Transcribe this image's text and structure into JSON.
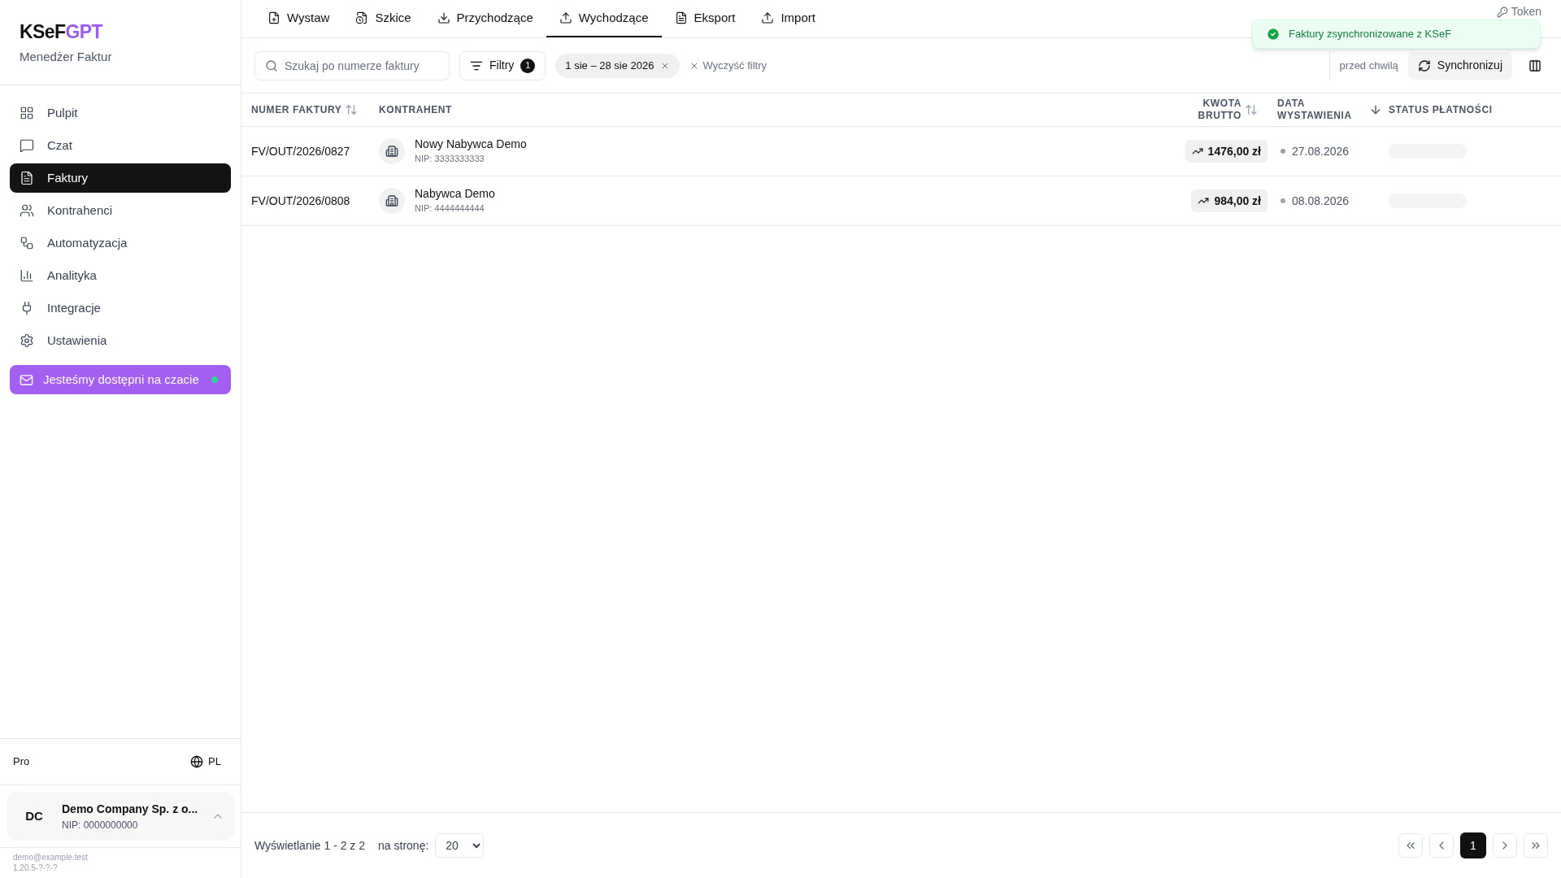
{
  "brand": {
    "name_part1": "KSeF",
    "name_part2": "GPT",
    "subtitle": "Menedżer Faktur"
  },
  "nav": [
    {
      "label": "Pulpit",
      "selected": false
    },
    {
      "label": "Czat",
      "selected": false
    },
    {
      "label": "Faktury",
      "selected": true
    },
    {
      "label": "Kontrahenci",
      "selected": false
    },
    {
      "label": "Automatyzacja",
      "selected": false
    },
    {
      "label": "Analityka",
      "selected": false
    },
    {
      "label": "Integracje",
      "selected": false
    },
    {
      "label": "Ustawienia",
      "selected": false
    }
  ],
  "chat_banner": {
    "label": "Jesteśmy dostępni na czacie",
    "online": true
  },
  "plan": "Pro",
  "language": "PL",
  "company": {
    "initials": "DC",
    "name": "Demo Company Sp. z o...",
    "nip": "NIP: 0000000000",
    "expanded": true
  },
  "footer": {
    "email": "demo@example.test",
    "version": "1.20.5-?-?-?"
  },
  "tabs": [
    {
      "label": "Wystaw",
      "selected": false
    },
    {
      "label": "Szkice",
      "selected": false
    },
    {
      "label": "Przychodzące",
      "selected": false
    },
    {
      "label": "Wychodzące",
      "selected": true
    },
    {
      "label": "Eksport",
      "selected": false
    },
    {
      "label": "Import",
      "selected": false
    }
  ],
  "token_label": "Token",
  "toast": {
    "message": "Faktury zsynchronizowane z KSeF"
  },
  "search": {
    "placeholder": "Szukaj po numerze faktury"
  },
  "filters_button": {
    "label": "Filtry",
    "count": "1"
  },
  "date_chip": "1 sie – 28 sie 2026",
  "clear_filters": "Wyczyść filtry",
  "last_sync": "przed chwilą",
  "sync_button": "Synchronizuj",
  "table": {
    "columns": [
      {
        "label": "NUMER FAKTURY"
      },
      {
        "label": "KONTRAHENT"
      },
      {
        "label": "KWOTA BRUTTO"
      },
      {
        "label": "DATA WYSTAWIENIA"
      },
      {
        "label": "STATUS PŁATNOŚCI"
      }
    ],
    "rows": [
      {
        "number": "FV/OUT/2026/0827",
        "name": "Nowy Nabywca Demo",
        "nip": "NIP: 3333333333",
        "amount": "1476,00 zł",
        "date": "27.08.2026"
      },
      {
        "number": "FV/OUT/2026/0808",
        "name": "Nabywca Demo",
        "nip": "NIP: 4444444444",
        "amount": "984,00 zł",
        "date": "08.08.2026"
      }
    ]
  },
  "pagination": {
    "summary": "Wyświetlanie 1 - 2 z 2",
    "per_page_label": "na stronę:",
    "per_page": "20",
    "pages": [
      {
        "label": "1",
        "selected": true
      }
    ]
  }
}
